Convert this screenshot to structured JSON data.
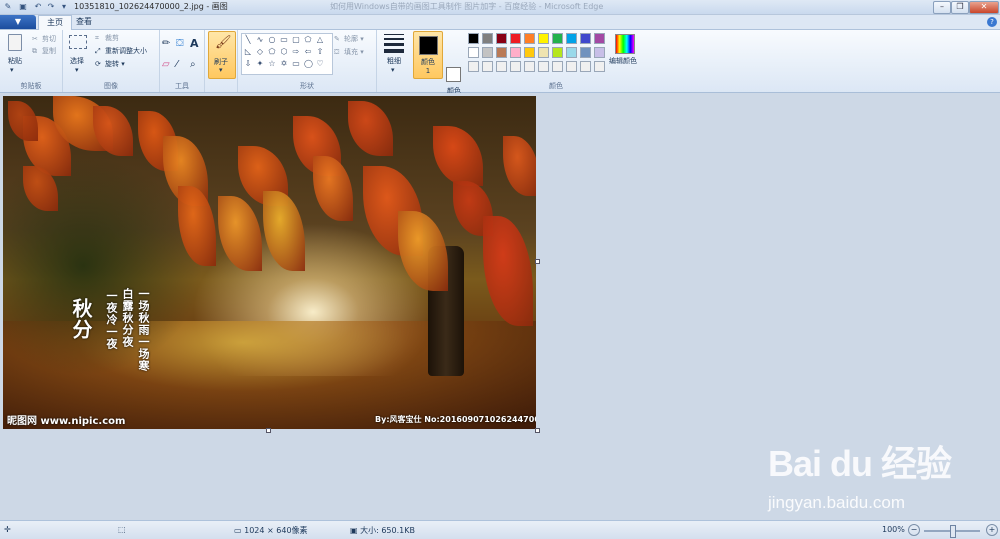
{
  "window": {
    "title": "10351810_102624470000_2.jpg - 画图",
    "faint_title": "如何用Windows自带的画图工具制作 图片加字 - 百度经验 - Microsoft Edge"
  },
  "tabs": {
    "menu": "▼",
    "home": "主页",
    "view": "查看"
  },
  "ribbon": {
    "clipboard": {
      "paste": "粘贴",
      "cut": "剪切",
      "copy": "复制",
      "label": "剪贴板"
    },
    "image": {
      "select": "选择",
      "crop": "裁剪",
      "resize": "重新调整大小",
      "rotate": "旋转",
      "label": "图像"
    },
    "tools": {
      "label": "工具"
    },
    "brush": {
      "label": "刷子"
    },
    "shapes": {
      "outline": "轮廓",
      "fill": "填充",
      "label": "形状"
    },
    "size": {
      "label": "粗细"
    },
    "color1": {
      "label": "颜色 1",
      "value": "#000000"
    },
    "color2": {
      "label": "颜色 2",
      "value": "#ffffff"
    },
    "colors": {
      "label": "颜色",
      "edit_label": "编辑颜色",
      "row1": [
        "#000000",
        "#7f7f7f",
        "#880015",
        "#ed1c24",
        "#ff7f27",
        "#fff200",
        "#22b14c",
        "#00a2e8",
        "#3f48cc",
        "#a349a4"
      ],
      "row2": [
        "#ffffff",
        "#c3c3c3",
        "#b97a57",
        "#ffaec9",
        "#ffc90e",
        "#efe4b0",
        "#b5e61d",
        "#99d9ea",
        "#7092be",
        "#c8bfe7"
      ],
      "row3": [
        "#f0f0f0",
        "#f0f0f0",
        "#f0f0f0",
        "#f0f0f0",
        "#f0f0f0",
        "#f0f0f0",
        "#f0f0f0",
        "#f0f0f0",
        "#f0f0f0",
        "#f0f0f0"
      ]
    }
  },
  "image": {
    "title_text": "秋分",
    "poem_col1": "一场秋雨一场寒",
    "poem_col2": "白露秋分夜",
    "poem_col3": "一夜冷一夜",
    "watermark_left": "昵图网 www.nipic.com",
    "watermark_right": "By:风客宝仕 No:20160907102624470000"
  },
  "statusbar": {
    "dimensions": "1024 × 640像素",
    "size": "大小: 650.1KB",
    "zoom": "100%"
  },
  "overlay": {
    "logo": "Bai du 经验",
    "url": "jingyan.baidu.com"
  }
}
